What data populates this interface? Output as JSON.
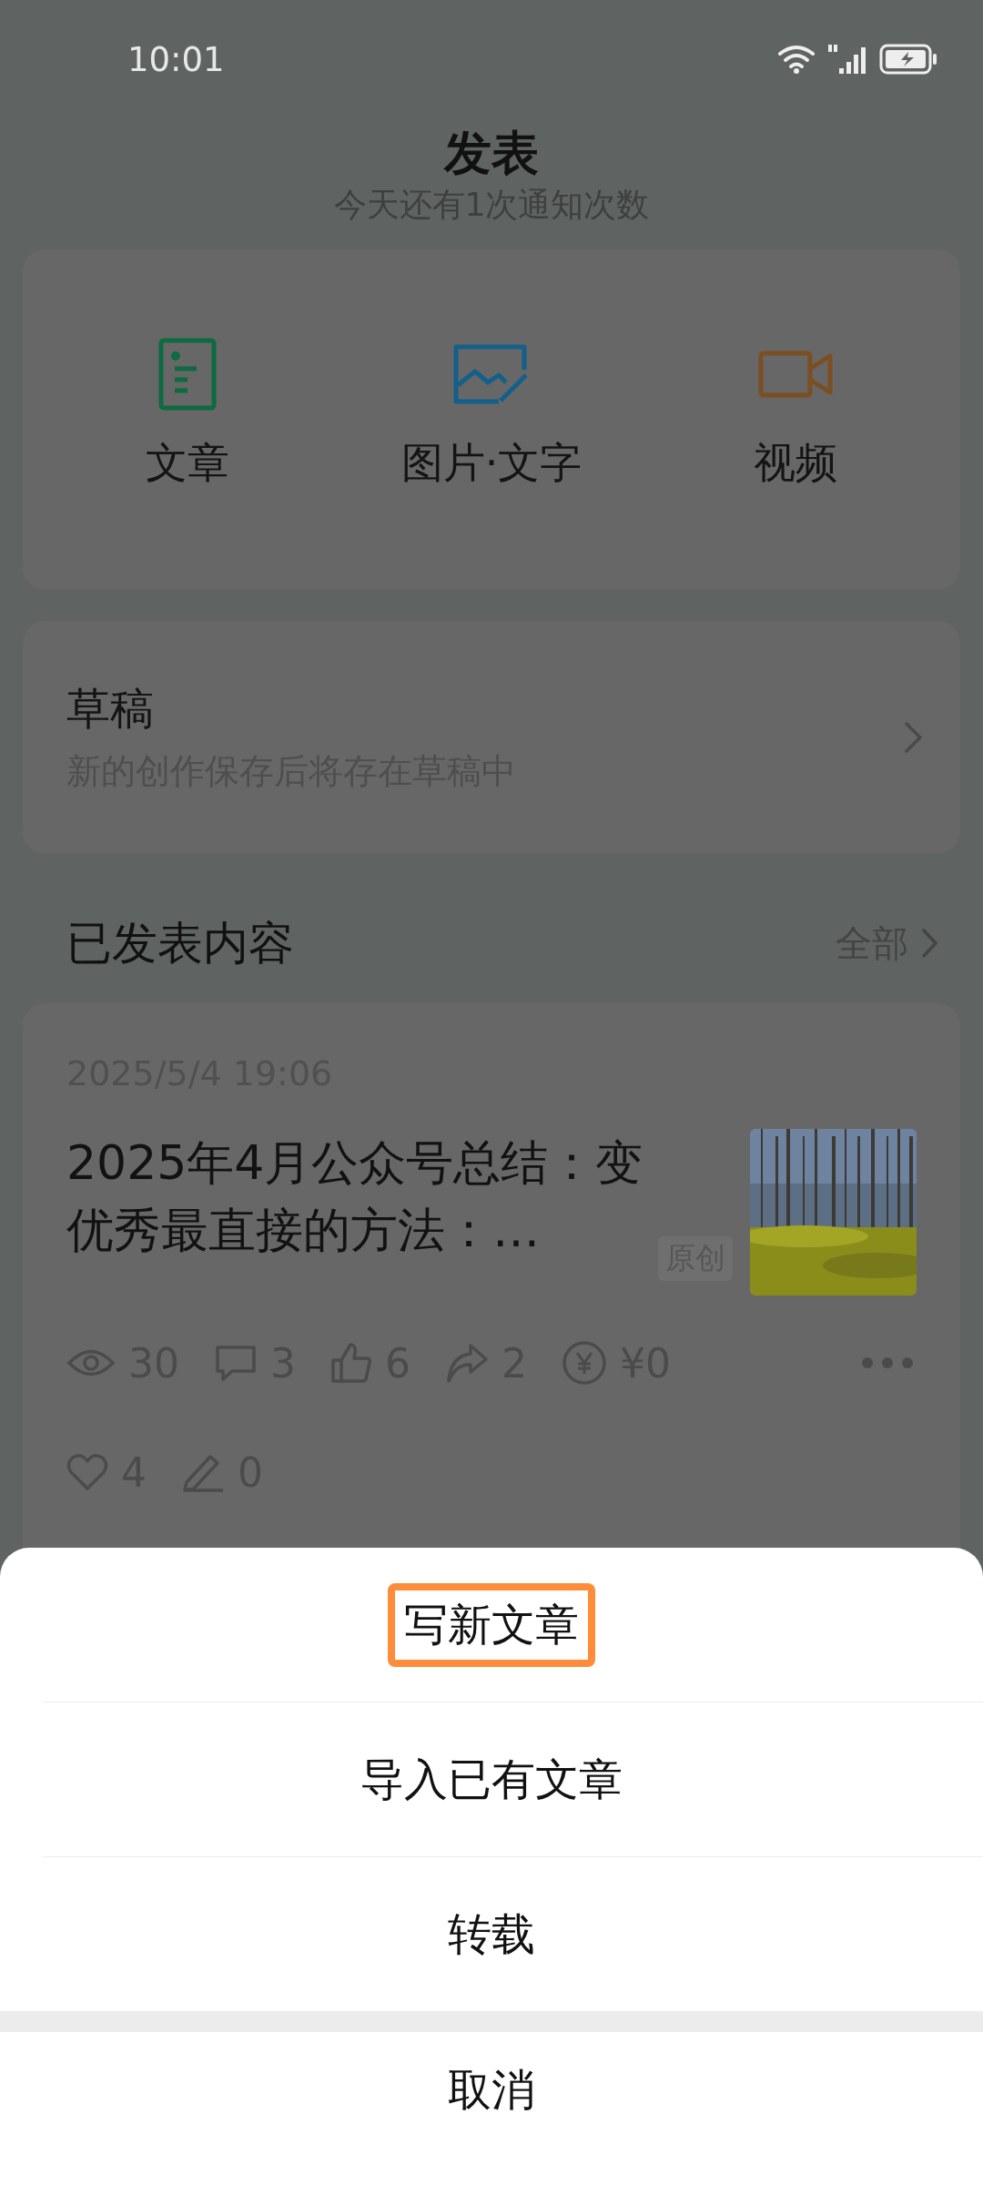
{
  "status_bar": {
    "time": "10:01"
  },
  "header": {
    "title": "发表",
    "subtitle": "今天还有1次通知次数"
  },
  "create_types": [
    {
      "kind": "article",
      "label": "文章"
    },
    {
      "kind": "image_text",
      "label": "图片·文字"
    },
    {
      "kind": "video",
      "label": "视频"
    }
  ],
  "drafts": {
    "title": "草稿",
    "subtitle": "新的创作保存后将存在草稿中"
  },
  "published": {
    "title": "已发表内容",
    "all_link": "全部",
    "posts": [
      {
        "date": "2025/5/4 19:06",
        "title": "2025年4月公众号总结：变优秀最直接的方法：…",
        "tag": "原创",
        "stats": [
          {
            "kind": "views",
            "value": "30"
          },
          {
            "kind": "comments",
            "value": "3"
          },
          {
            "kind": "likes",
            "value": "6"
          },
          {
            "kind": "shares",
            "value": "2"
          },
          {
            "kind": "income",
            "value": "¥0"
          },
          {
            "kind": "favorites",
            "value": "4"
          },
          {
            "kind": "edits",
            "value": "0"
          }
        ]
      }
    ]
  },
  "action_sheet": {
    "items": [
      {
        "label": "写新文章",
        "highlighted": true
      },
      {
        "label": "导入已有文章",
        "highlighted": false
      },
      {
        "label": "转载",
        "highlighted": false
      }
    ],
    "cancel": "取消"
  }
}
